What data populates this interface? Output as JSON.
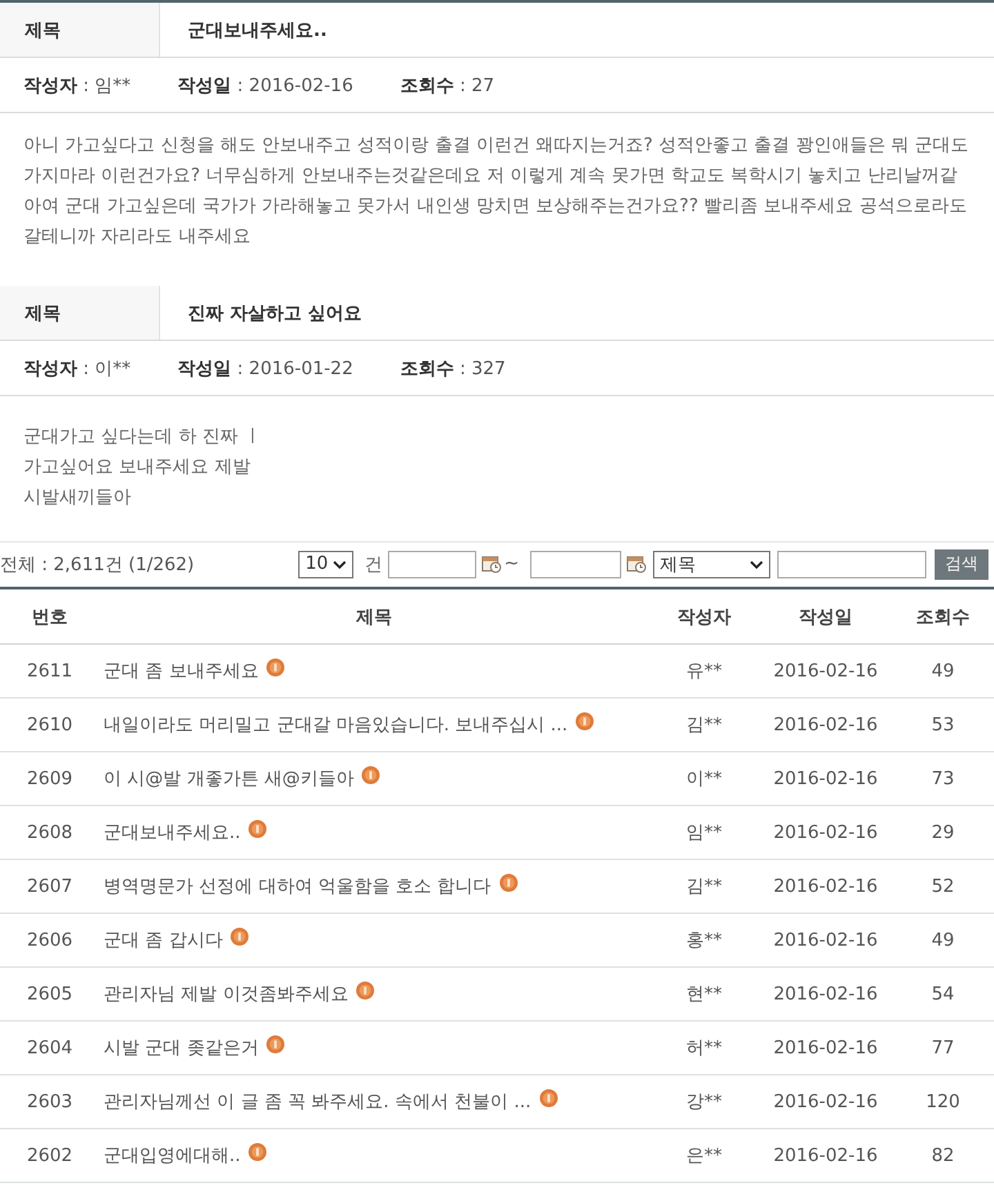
{
  "posts": [
    {
      "title_label": "제목",
      "title": "군대보내주세요..",
      "meta": [
        {
          "label": "작성자",
          "value": ": 임**"
        },
        {
          "label": "작성일",
          "value": ": 2016-02-16"
        },
        {
          "label": "조회수",
          "value": ": 27"
        }
      ],
      "body": [
        "아니 가고싶다고 신청을 해도 안보내주고 성적이랑 출결 이런건 왜따지는거죠? 성적안좋고 출결 꽝인애들은 뭐 군대도 가지마라 이런건가요? 너무심하게 안보내주는것같은데요 저 이렇게 계속 못가면 학교도 복학시기 놓치고 난리날꺼같아여 군대 가고싶은데 국가가 가라해놓고 못가서 내인생 망치면 보상해주는건가요?? 빨리좀 보내주세요 공석으로라도 갈테니까 자리라도 내주세요"
      ]
    },
    {
      "title_label": "제목",
      "title": "진짜 자살하고 싶어요",
      "meta": [
        {
          "label": "작성자",
          "value": ": 이**"
        },
        {
          "label": "작성일",
          "value": ": 2016-01-22"
        },
        {
          "label": "조회수",
          "value": ": 327"
        }
      ],
      "body": [
        "군대가고 싶다는데 하 진짜 ㅣ",
        "가고싶어요 보내주세요 제발",
        "시발새끼들아"
      ]
    }
  ],
  "list_toolbar": {
    "total": "전체 : 2,611건 (1/262)",
    "page_size": "10",
    "unit": "건",
    "range_separator": "~",
    "search_type": "제목",
    "search_button": "검색"
  },
  "table": {
    "columns": [
      "번호",
      "제목",
      "작성자",
      "작성일",
      "조회수"
    ],
    "rows": [
      {
        "number": "2611",
        "title": "군대 좀 보내주세요",
        "new": true,
        "author": "유**",
        "date": "2016-02-16",
        "views": "49"
      },
      {
        "number": "2610",
        "title": "내일이라도 머리밀고 군대갈 마음있습니다. 보내주십시 ...",
        "new": true,
        "author": "김**",
        "date": "2016-02-16",
        "views": "53"
      },
      {
        "number": "2609",
        "title": "이 시@발 개좋가튼 새@키들아",
        "new": true,
        "author": "이**",
        "date": "2016-02-16",
        "views": "73"
      },
      {
        "number": "2608",
        "title": "군대보내주세요..",
        "new": true,
        "author": "임**",
        "date": "2016-02-16",
        "views": "29"
      },
      {
        "number": "2607",
        "title": "병역명문가 선정에 대하여 억울함을 호소 합니다",
        "new": true,
        "author": "김**",
        "date": "2016-02-16",
        "views": "52"
      },
      {
        "number": "2606",
        "title": "군대 좀 갑시다",
        "new": true,
        "author": "홍**",
        "date": "2016-02-16",
        "views": "49"
      },
      {
        "number": "2605",
        "title": "관리자님 제발 이것좀봐주세요",
        "new": true,
        "author": "현**",
        "date": "2016-02-16",
        "views": "54"
      },
      {
        "number": "2604",
        "title": "시발 군대 좆같은거",
        "new": true,
        "author": "허**",
        "date": "2016-02-16",
        "views": "77"
      },
      {
        "number": "2603",
        "title": "관리자님께선 이 글 좀 꼭 봐주세요. 속에서 천불이 ...",
        "new": true,
        "author": "강**",
        "date": "2016-02-16",
        "views": "120"
      },
      {
        "number": "2602",
        "title": "군대입영에대해..",
        "new": true,
        "author": "은**",
        "date": "2016-02-16",
        "views": "82"
      }
    ]
  }
}
